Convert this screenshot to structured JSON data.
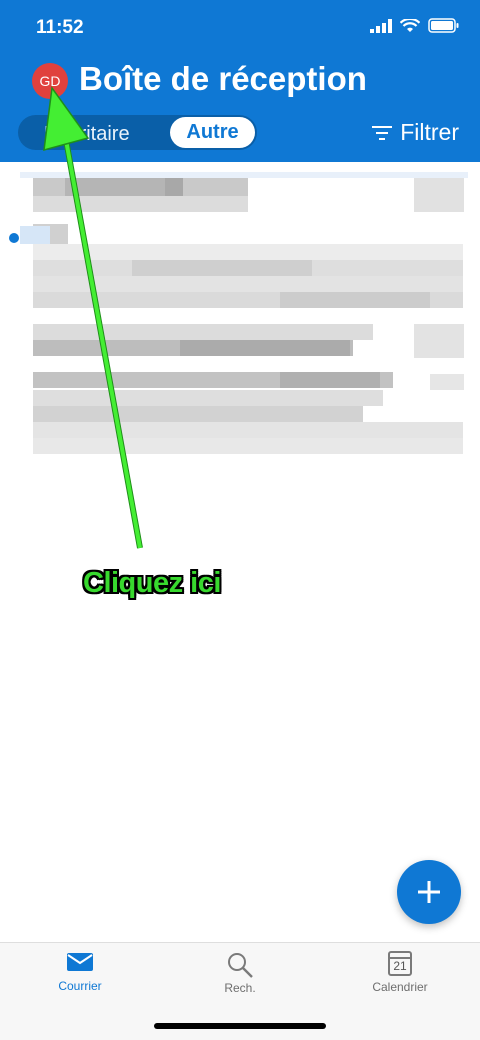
{
  "status_bar": {
    "time": "11:52"
  },
  "header": {
    "avatar_initials": "GD",
    "title": "Boîte de réception",
    "tabs": [
      {
        "label": "Prioritaire",
        "selected": false
      },
      {
        "label": "Autre",
        "selected": true
      }
    ],
    "filter_label": "Filtrer"
  },
  "annotation": {
    "text": "Cliquez ici"
  },
  "tab_bar": {
    "items": [
      {
        "label": "Courrier",
        "icon": "mail-icon",
        "active": true
      },
      {
        "label": "Rech.",
        "icon": "search-icon",
        "active": false
      },
      {
        "label": "Calendrier",
        "icon": "calendar-icon",
        "active": false,
        "date": "21"
      }
    ]
  },
  "colors": {
    "accent": "#0f78d4",
    "avatar": "#e0413d",
    "annotation_green": "#38d92e"
  }
}
